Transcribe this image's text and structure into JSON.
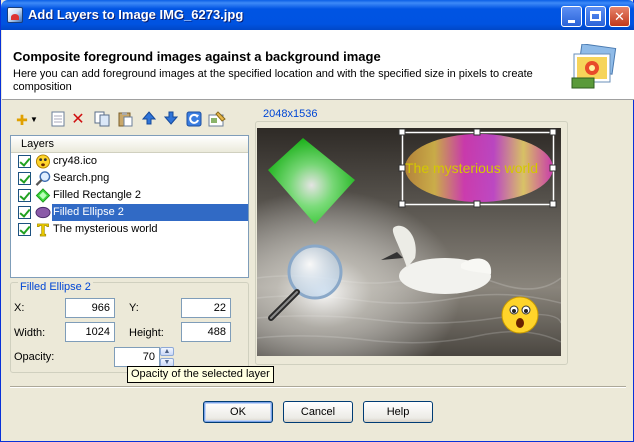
{
  "window": {
    "title": "Add Layers to Image IMG_6273.jpg"
  },
  "header": {
    "title": "Composite foreground images against a background image",
    "description": "Here you can add foreground images at the specified location and with the specified size in pixels to create composition"
  },
  "toolbar": {
    "icons": [
      "add-icon",
      "dropdown-arrow-icon",
      "new-icon",
      "delete-icon",
      "copy-icon",
      "paste-icon",
      "move-up-icon",
      "move-down-icon",
      "refresh-icon",
      "properties-icon"
    ]
  },
  "layers": {
    "header": "Layers",
    "items": [
      {
        "name": "cry48.ico",
        "checked": true,
        "icon": "smiley-icon"
      },
      {
        "name": "Search.png",
        "checked": true,
        "icon": "magnifier-icon"
      },
      {
        "name": "Filled Rectangle 2",
        "checked": true,
        "icon": "diamond-icon"
      },
      {
        "name": "Filled Ellipse 2",
        "checked": true,
        "icon": "ellipse-icon",
        "selected": true
      },
      {
        "name": "The mysterious world",
        "checked": true,
        "icon": "text-icon"
      }
    ]
  },
  "properties": {
    "group_title": "Filled Ellipse 2",
    "x_label": "X:",
    "x_value": "966",
    "y_label": "Y:",
    "y_value": "22",
    "width_label": "Width:",
    "width_value": "1024",
    "height_label": "Height:",
    "height_value": "488",
    "opacity_label": "Opacity:",
    "opacity_value": "70",
    "opacity_tooltip": "Opacity of the selected layer"
  },
  "preview": {
    "dimensions": "2048x1536",
    "overlay_text": "The mysterious world"
  },
  "buttons": {
    "ok": "OK",
    "cancel": "Cancel",
    "help": "Help"
  },
  "colors": {
    "accent": "#0046d5",
    "selection": "#316ac5",
    "titlebar": "#0054e3",
    "overlay_text": "#d4c800"
  }
}
